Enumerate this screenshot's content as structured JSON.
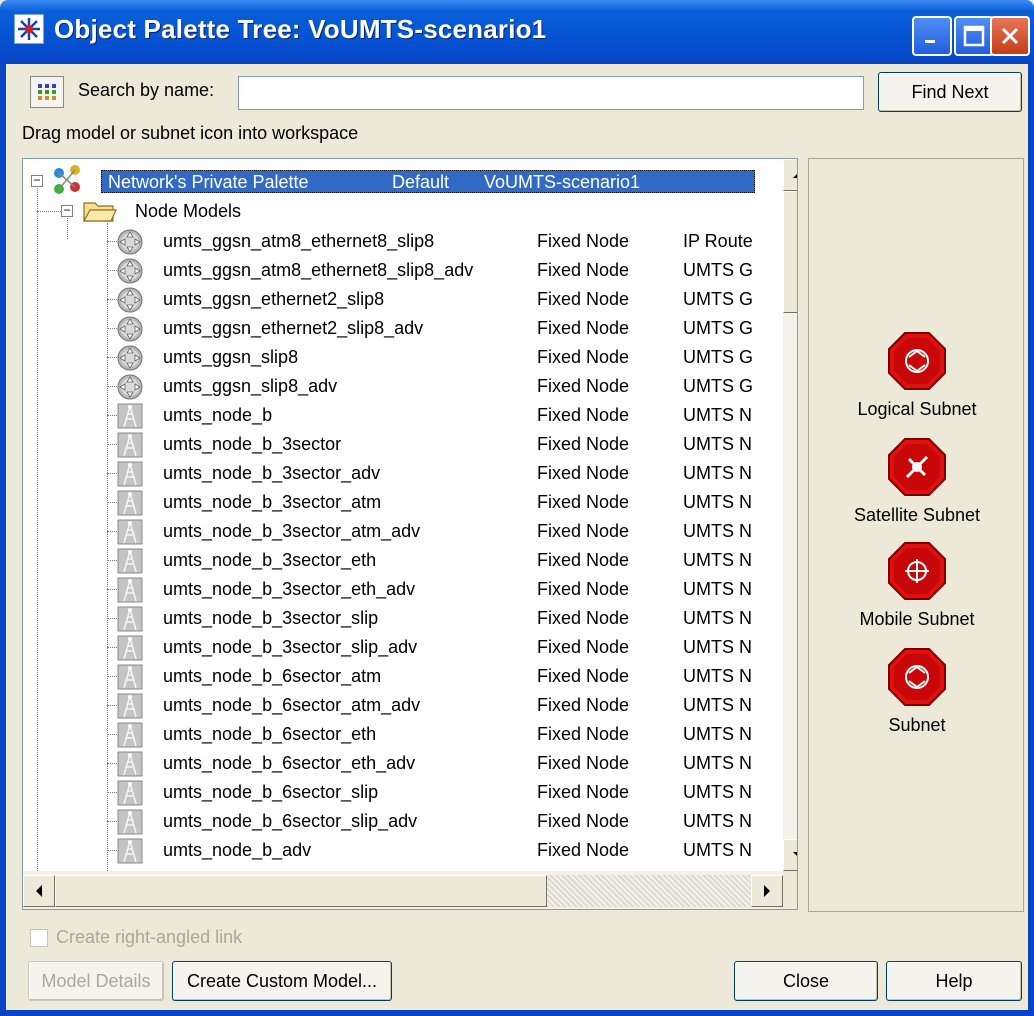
{
  "window": {
    "title": "Object Palette Tree: VoUMTS-scenario1"
  },
  "search": {
    "label": "Search by name:",
    "value": "",
    "find_next_label": "Find Next"
  },
  "hint": "Drag model or subnet icon into workspace",
  "tree": {
    "root": {
      "name": "Network's Private Palette",
      "kind": "Default",
      "desc": "VoUMTS-scenario1"
    },
    "folder": "Node Models",
    "items": [
      {
        "name": "umts_ggsn_atm8_ethernet8_slip8",
        "kind": "Fixed Node",
        "desc": "IP Route",
        "icon": "router-icon"
      },
      {
        "name": "umts_ggsn_atm8_ethernet8_slip8_adv",
        "kind": "Fixed Node",
        "desc": "UMTS G",
        "icon": "router-icon"
      },
      {
        "name": "umts_ggsn_ethernet2_slip8",
        "kind": "Fixed Node",
        "desc": "UMTS G",
        "icon": "router-icon"
      },
      {
        "name": "umts_ggsn_ethernet2_slip8_adv",
        "kind": "Fixed Node",
        "desc": "UMTS G",
        "icon": "router-icon"
      },
      {
        "name": "umts_ggsn_slip8",
        "kind": "Fixed Node",
        "desc": "UMTS G",
        "icon": "router-icon"
      },
      {
        "name": "umts_ggsn_slip8_adv",
        "kind": "Fixed Node",
        "desc": "UMTS G",
        "icon": "router-icon"
      },
      {
        "name": "umts_node_b",
        "kind": "Fixed Node",
        "desc": "UMTS N",
        "icon": "antenna-tower-icon"
      },
      {
        "name": "umts_node_b_3sector",
        "kind": "Fixed Node",
        "desc": "UMTS N",
        "icon": "antenna-tower-icon"
      },
      {
        "name": "umts_node_b_3sector_adv",
        "kind": "Fixed Node",
        "desc": "UMTS N",
        "icon": "antenna-tower-icon"
      },
      {
        "name": "umts_node_b_3sector_atm",
        "kind": "Fixed Node",
        "desc": "UMTS N",
        "icon": "antenna-tower-icon"
      },
      {
        "name": "umts_node_b_3sector_atm_adv",
        "kind": "Fixed Node",
        "desc": "UMTS N",
        "icon": "antenna-tower-icon"
      },
      {
        "name": "umts_node_b_3sector_eth",
        "kind": "Fixed Node",
        "desc": "UMTS N",
        "icon": "antenna-tower-icon"
      },
      {
        "name": "umts_node_b_3sector_eth_adv",
        "kind": "Fixed Node",
        "desc": "UMTS N",
        "icon": "antenna-tower-icon"
      },
      {
        "name": "umts_node_b_3sector_slip",
        "kind": "Fixed Node",
        "desc": "UMTS N",
        "icon": "antenna-tower-icon"
      },
      {
        "name": "umts_node_b_3sector_slip_adv",
        "kind": "Fixed Node",
        "desc": "UMTS N",
        "icon": "antenna-tower-icon"
      },
      {
        "name": "umts_node_b_6sector_atm",
        "kind": "Fixed Node",
        "desc": "UMTS N",
        "icon": "antenna-tower-icon"
      },
      {
        "name": "umts_node_b_6sector_atm_adv",
        "kind": "Fixed Node",
        "desc": "UMTS N",
        "icon": "antenna-tower-icon"
      },
      {
        "name": "umts_node_b_6sector_eth",
        "kind": "Fixed Node",
        "desc": "UMTS N",
        "icon": "antenna-tower-icon"
      },
      {
        "name": "umts_node_b_6sector_eth_adv",
        "kind": "Fixed Node",
        "desc": "UMTS N",
        "icon": "antenna-tower-icon"
      },
      {
        "name": "umts_node_b_6sector_slip",
        "kind": "Fixed Node",
        "desc": "UMTS N",
        "icon": "antenna-tower-icon"
      },
      {
        "name": "umts_node_b_6sector_slip_adv",
        "kind": "Fixed Node",
        "desc": "UMTS N",
        "icon": "antenna-tower-icon"
      },
      {
        "name": "umts_node_b_adv",
        "kind": "Fixed Node",
        "desc": "UMTS N",
        "icon": "antenna-tower-icon"
      }
    ]
  },
  "subnets": [
    {
      "label": "Logical Subnet",
      "icon": "logical-subnet-icon"
    },
    {
      "label": "Satellite Subnet",
      "icon": "satellite-subnet-icon"
    },
    {
      "label": "Mobile Subnet",
      "icon": "mobile-subnet-icon"
    },
    {
      "label": "Subnet",
      "icon": "subnet-icon"
    }
  ],
  "options": {
    "right_angle_label": "Create right-angled link",
    "right_angle_checked": false
  },
  "buttons": {
    "model_details": "Model Details",
    "create_custom_model": "Create Custom Model...",
    "close": "Close",
    "help": "Help"
  },
  "colors": {
    "title_bar": "#0553d3",
    "selection": "#316ac5",
    "subnet_red": "#e01010",
    "window_bg": "#ece9d8"
  }
}
